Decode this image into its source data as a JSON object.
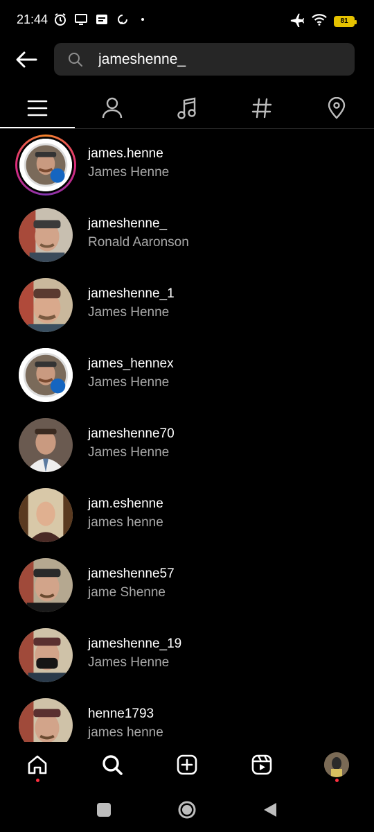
{
  "status_bar": {
    "time": "21:44",
    "battery": "81",
    "icons_left": [
      "alarm-icon",
      "screen-icon",
      "news-icon",
      "sync-icon"
    ],
    "icons_right": [
      "airplane-icon",
      "wifi-icon",
      "battery-icon"
    ]
  },
  "search": {
    "query": "jameshenne_",
    "placeholder": "Search"
  },
  "tabs": [
    {
      "name": "top",
      "icon": "list-icon",
      "active": true
    },
    {
      "name": "accounts",
      "icon": "person-icon",
      "active": false
    },
    {
      "name": "audio",
      "icon": "music-note-icon",
      "active": false
    },
    {
      "name": "tags",
      "icon": "hashtag-icon",
      "active": false
    },
    {
      "name": "places",
      "icon": "location-pin-icon",
      "active": false
    }
  ],
  "results": [
    {
      "username": "james.henne",
      "full_name": "James Henne"
    },
    {
      "username": "jameshenne_",
      "full_name": "Ronald Aaronson"
    },
    {
      "username": "jameshenne_1",
      "full_name": "James Henne"
    },
    {
      "username": "james_hennex",
      "full_name": "James Henne"
    },
    {
      "username": "jameshenne70",
      "full_name": "James Henne"
    },
    {
      "username": "jam.eshenne",
      "full_name": "james henne"
    },
    {
      "username": "jameshenne57",
      "full_name": "jame Shenne"
    },
    {
      "username": "jameshenne_19",
      "full_name": "James Henne"
    },
    {
      "username": "henne1793",
      "full_name": "james henne"
    }
  ],
  "bottom_nav": [
    "home-icon",
    "search-icon",
    "create-icon",
    "reels-icon",
    "profile-avatar"
  ],
  "colors": {
    "background": "#000000",
    "search_bg": "#262626",
    "secondary_text": "#a8a8a8",
    "notification_dot": "#ff3040",
    "story_ring": "#dd2a7b"
  }
}
